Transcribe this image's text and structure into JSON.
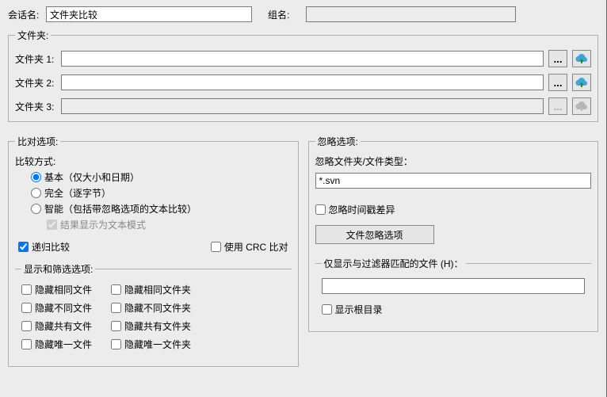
{
  "header": {
    "session_label": "会话名:",
    "session_value": "文件夹比较",
    "group_label": "组名:",
    "group_value": ""
  },
  "folders": {
    "legend": "文件夹:",
    "rows": [
      {
        "label": "文件夹 1:",
        "value": "",
        "browse": "...",
        "enabled": true
      },
      {
        "label": "文件夹 2:",
        "value": "",
        "browse": "...",
        "enabled": true
      },
      {
        "label": "文件夹 3:",
        "value": "",
        "browse": "...",
        "enabled": false
      }
    ]
  },
  "compare": {
    "legend": "比对选项:",
    "method_legend": "比较方式:",
    "radios": {
      "basic": "基本（仅大小和日期）",
      "full": "完全（逐字节）",
      "smart": "智能（包括带忽略选项的文本比较）"
    },
    "show_as_text": "结果显示为文本模式",
    "recursive": "递归比较",
    "crc": "使用 CRC 比对",
    "display_legend": "显示和筛选选项:",
    "checks": {
      "hide_same_file": "隐藏相同文件",
      "hide_diff_file": "隐藏不同文件",
      "hide_excl_file": "隐藏共有文件",
      "hide_uniq_file": "隐藏唯一文件",
      "hide_same_folder": "隐藏相同文件夹",
      "hide_diff_folder": "隐藏不同文件夹",
      "hide_excl_folder": "隐藏共有文件夹",
      "hide_uniq_folder": "隐藏唯一文件夹"
    }
  },
  "ignore": {
    "legend": "忽略选项:",
    "types_label": "忽略文件夹/文件类型：",
    "types_value": "*.svn",
    "time_diff": "忽略时间戳差异",
    "filter_button": "文件忽略选项",
    "filter_legend": "仅显示与过滤器匹配的文件 (H)：",
    "filter_value": "",
    "show_root": "显示根目录"
  }
}
